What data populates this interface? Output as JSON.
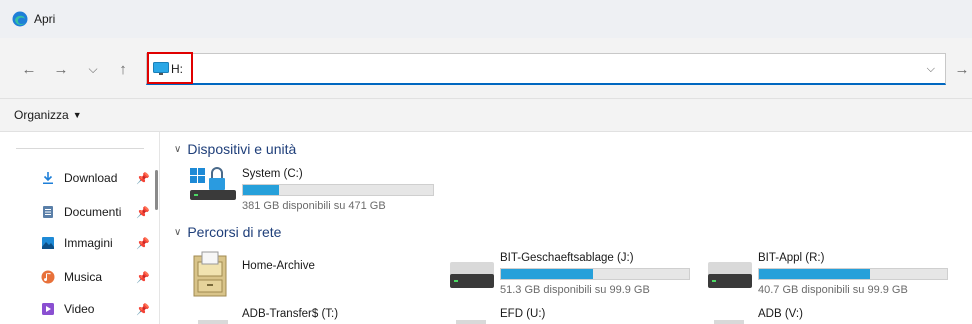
{
  "window": {
    "title": "Apri"
  },
  "navbar": {
    "back_icon": "←",
    "forward_icon": "→",
    "history_icon": "⌵",
    "up_icon": "↑",
    "address_value": "H:",
    "dropdown_icon": "⌵",
    "go_icon": "→"
  },
  "toolbar": {
    "organize_label": "Organizza",
    "organize_caret": "▼"
  },
  "sidebar": {
    "items": [
      {
        "label": "Download",
        "icon": "download-icon"
      },
      {
        "label": "Documenti",
        "icon": "documents-icon"
      },
      {
        "label": "Immagini",
        "icon": "pictures-icon"
      },
      {
        "label": "Musica",
        "icon": "music-icon"
      },
      {
        "label": "Video",
        "icon": "video-icon"
      }
    ],
    "pin_glyph": "📌"
  },
  "content": {
    "groups": [
      {
        "label": "Dispositivi e unità"
      },
      {
        "label": "Percorsi di rete"
      }
    ],
    "devices": [
      {
        "name": "System (C:)",
        "free": "381 GB disponibili su 471 GB",
        "used_fraction": 0.19
      }
    ],
    "network": [
      {
        "name": "Home-Archive"
      },
      {
        "name": "BIT-Geschaeftsablage (J:)",
        "free": "51.3 GB disponibili su 99.9 GB",
        "used_fraction": 0.49
      },
      {
        "name": "BIT-Appl (R:)",
        "free": "40.7 GB disponibili su 99.9 GB",
        "used_fraction": 0.59
      },
      {
        "name": "ADB-Transfer$ (T:)"
      },
      {
        "name": "EFD (U:)"
      },
      {
        "name": "ADB (V:)"
      }
    ]
  },
  "colors": {
    "accent": "#0067c0",
    "bar_fill": "#26a0da",
    "highlight": "#e00000",
    "group_text": "#1f3f7a"
  }
}
